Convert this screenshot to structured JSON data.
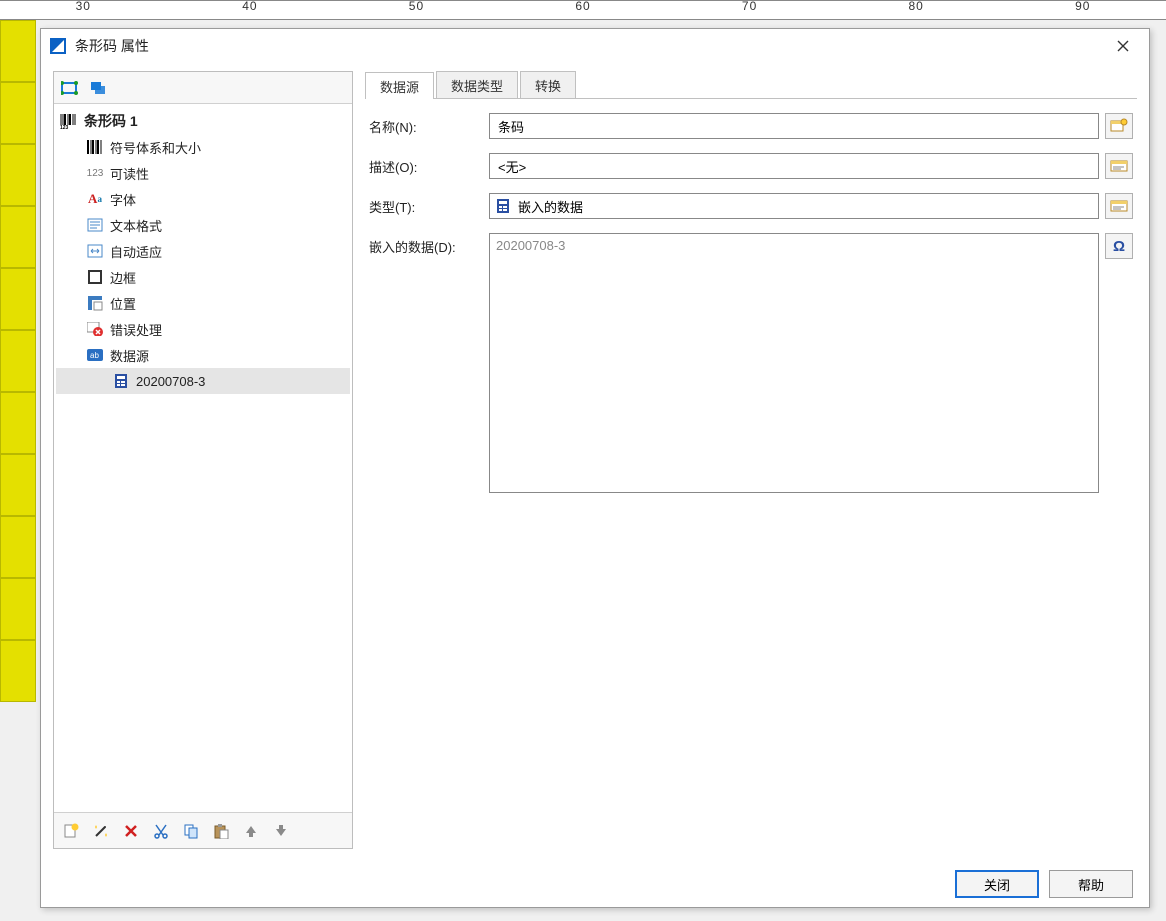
{
  "bg": {
    "ruler_ticks": [
      "30",
      "40",
      "50",
      "60",
      "70",
      "80",
      "90"
    ]
  },
  "window": {
    "title": "条形码 属性"
  },
  "tree": {
    "root": "条形码 1",
    "items": [
      {
        "label": "符号体系和大小"
      },
      {
        "label": "可读性"
      },
      {
        "label": "字体"
      },
      {
        "label": "文本格式"
      },
      {
        "label": "自动适应"
      },
      {
        "label": "边框"
      },
      {
        "label": "位置"
      },
      {
        "label": "错误处理"
      },
      {
        "label": "数据源"
      }
    ],
    "datasource_child": "20200708-3"
  },
  "tabs": {
    "t0": "数据源",
    "t1": "数据类型",
    "t2": "转换"
  },
  "form": {
    "name_label": "名称(N):",
    "name_value": "条码",
    "desc_label": "描述(O):",
    "desc_value": "<无>",
    "type_label": "类型(T):",
    "type_value": "嵌入的数据",
    "embed_label": "嵌入的数据(D):",
    "embed_value": "20200708-3"
  },
  "footer": {
    "close": "关闭",
    "help": "帮助"
  }
}
